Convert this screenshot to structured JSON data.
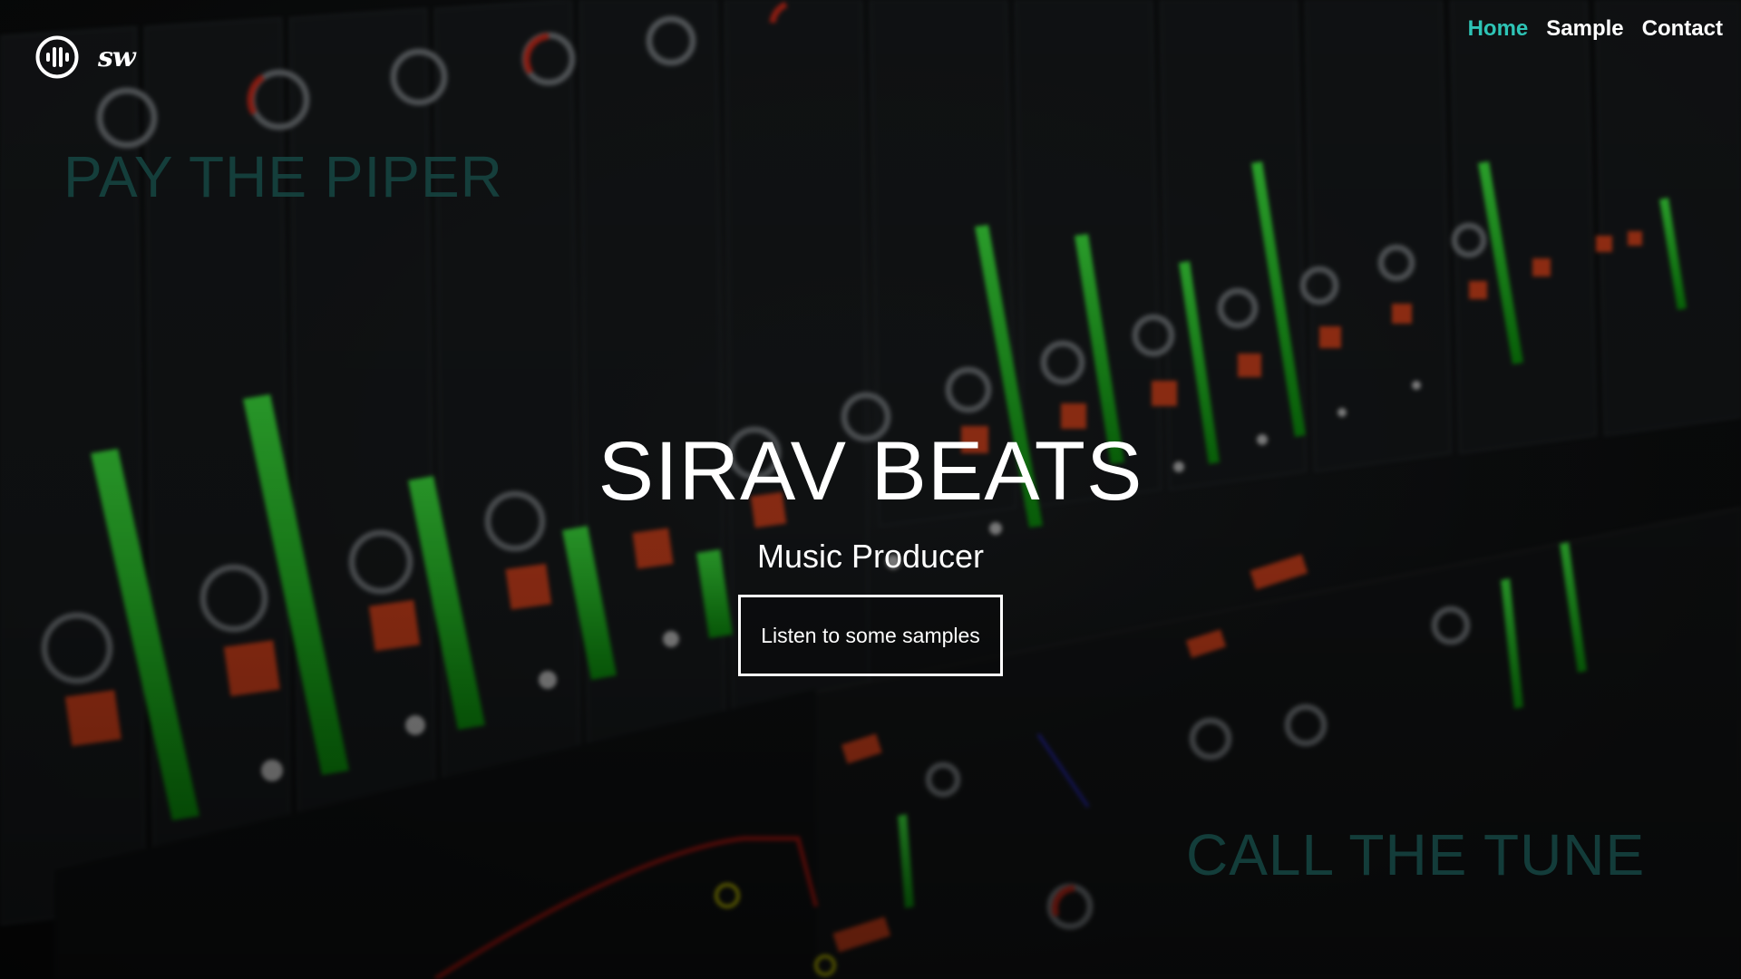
{
  "brand": {
    "logo_icon": "sound-wave-circle-icon",
    "script_text": "sw"
  },
  "nav": {
    "items": [
      {
        "label": "Home",
        "active": true
      },
      {
        "label": "Sample",
        "active": false
      },
      {
        "label": "Contact",
        "active": false
      }
    ]
  },
  "hero": {
    "title": "SIRAV BEATS",
    "subtitle": "Music Producer",
    "cta_label": "Listen to some samples",
    "slogan_top": "PAY THE PIPER",
    "slogan_bottom": "CALL THE TUNE"
  },
  "colors": {
    "accent": "#2ec4b6",
    "text": "#ffffff",
    "slogan": "#164a46",
    "meter_green": "#1fd01f",
    "mute_orange": "#e8461c"
  }
}
